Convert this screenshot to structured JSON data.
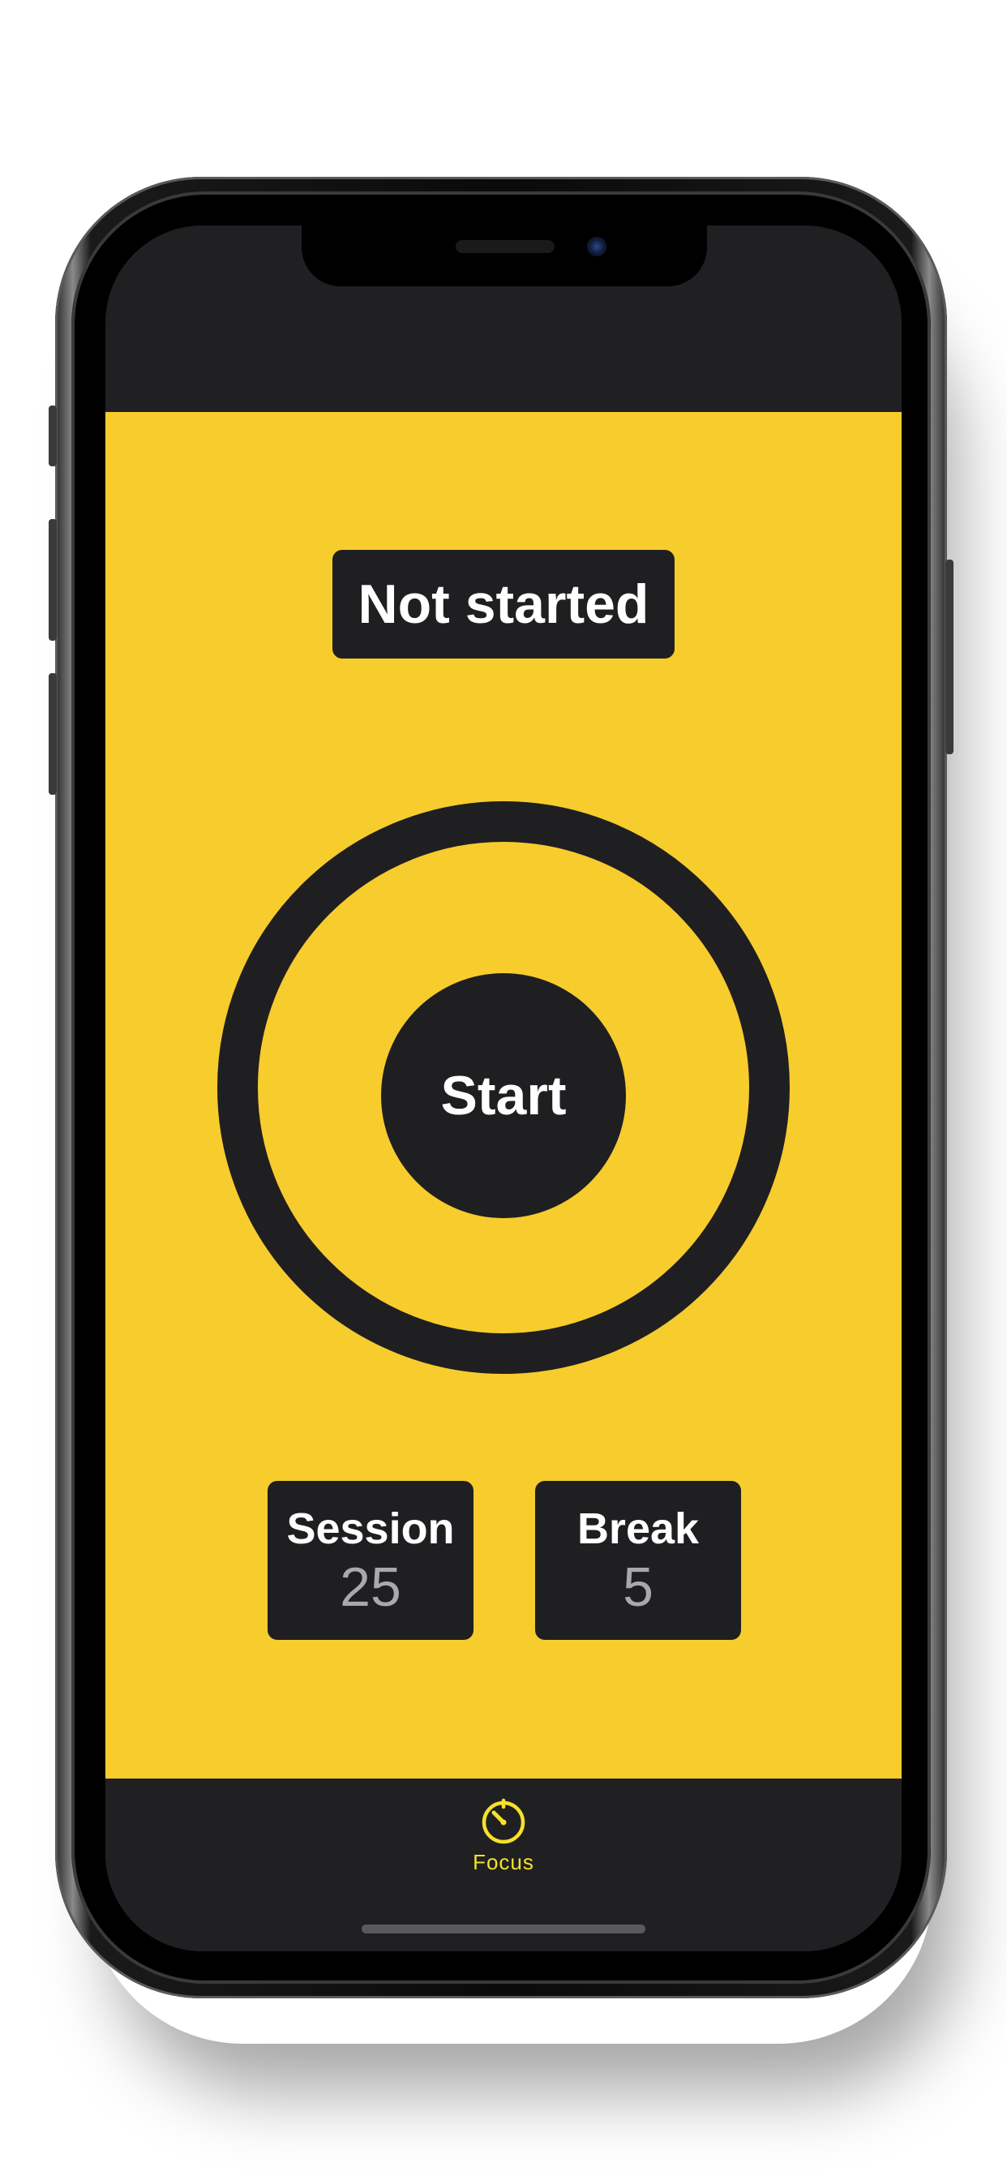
{
  "app": {
    "status_text": "Not started",
    "start_label": "Start",
    "session": {
      "title": "Session",
      "value": "25"
    },
    "break": {
      "title": "Break",
      "value": "5"
    }
  },
  "tabbar": {
    "items": [
      {
        "label": "Focus",
        "icon": "timer-icon",
        "selected": true
      }
    ]
  },
  "colors": {
    "background": "#f7cc2d",
    "dark": "#1f1f21",
    "accent": "#f5e12a",
    "muted_text": "#a9a9ab"
  }
}
